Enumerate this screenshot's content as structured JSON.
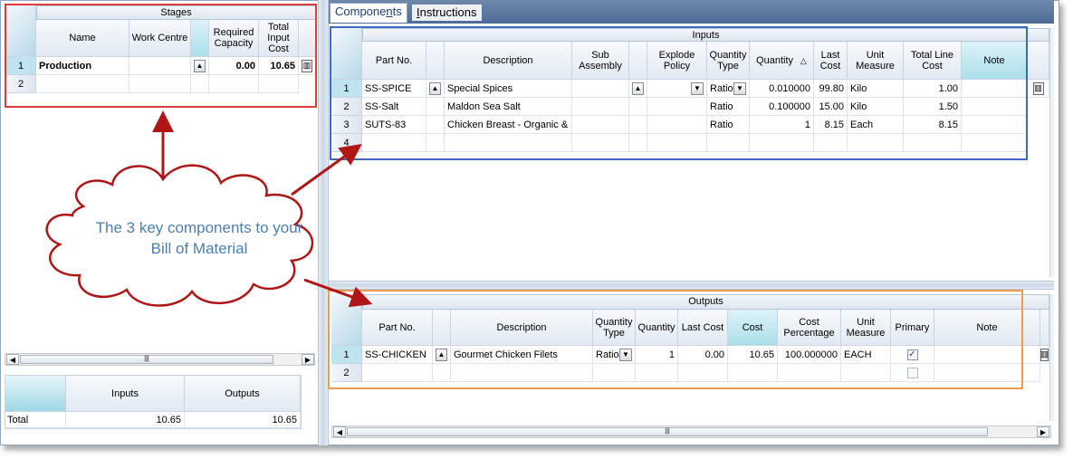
{
  "tabs": [
    {
      "label": "Components"
    },
    {
      "label": "Instructions"
    }
  ],
  "stages": {
    "title": "Stages",
    "headers": {
      "name": "Name",
      "work_centre": "Work Centre",
      "required_capacity": "Required Capacity",
      "total_input_cost": "Total Input Cost"
    },
    "rows": [
      {
        "num": "1",
        "name": "Production",
        "work_centre": "",
        "required_capacity": "0.00",
        "total_input_cost": "10.65"
      },
      {
        "num": "2",
        "name": "",
        "work_centre": "",
        "required_capacity": "",
        "total_input_cost": ""
      }
    ]
  },
  "summary": {
    "headers": {
      "inputs": "Inputs",
      "outputs": "Outputs"
    },
    "total_label": "Total",
    "inputs_total": "10.65",
    "outputs_total": "10.65"
  },
  "inputs": {
    "title": "Inputs",
    "headers": {
      "part_no": "Part No.",
      "description": "Description",
      "sub_assembly": "Sub Assembly",
      "explode_policy": "Explode Policy",
      "quantity_type": "Quantity Type",
      "quantity": "Quantity",
      "last_cost": "Last Cost",
      "unit_measure": "Unit Measure",
      "total_line_cost": "Total Line Cost",
      "note": "Note"
    },
    "rows": [
      {
        "num": "1",
        "part_no": "SS-SPICE",
        "description": "Special Spices",
        "quantity_type": "Ratio",
        "quantity": "0.010000",
        "last_cost": "99.80",
        "unit_measure": "Kilo",
        "total_line_cost": "1.00"
      },
      {
        "num": "2",
        "part_no": "SS-Salt",
        "description": "Maldon Sea Salt",
        "quantity_type": "Ratio",
        "quantity": "0.100000",
        "last_cost": "15.00",
        "unit_measure": "Kilo",
        "total_line_cost": "1.50"
      },
      {
        "num": "3",
        "part_no": "SUTS-83",
        "description": "Chicken Breast - Organic & M",
        "quantity_type": "Ratio",
        "quantity": "1",
        "last_cost": "8.15",
        "unit_measure": "Each",
        "total_line_cost": "8.15"
      },
      {
        "num": "4",
        "part_no": "",
        "description": "",
        "quantity_type": "",
        "quantity": "",
        "last_cost": "",
        "unit_measure": "",
        "total_line_cost": ""
      }
    ]
  },
  "outputs": {
    "title": "Outputs",
    "headers": {
      "part_no": "Part No.",
      "description": "Description",
      "quantity_type": "Quantity Type",
      "quantity": "Quantity",
      "last_cost": "Last Cost",
      "cost": "Cost",
      "cost_percentage": "Cost Percentage",
      "unit_measure": "Unit Measure",
      "primary": "Primary",
      "note": "Note"
    },
    "rows": [
      {
        "num": "1",
        "part_no": "SS-CHICKEN",
        "description": "Gourmet Chicken Filets",
        "quantity_type": "Ratio",
        "quantity": "1",
        "last_cost": "0.00",
        "cost": "10.65",
        "cost_percentage": "100.000000",
        "unit_measure": "EACH",
        "primary": true
      },
      {
        "num": "2",
        "part_no": "",
        "description": "",
        "quantity_type": "",
        "quantity": "",
        "last_cost": "",
        "cost": "",
        "cost_percentage": "",
        "unit_measure": "",
        "primary": false
      }
    ]
  },
  "callout": {
    "text": "The 3 key components to your Bill of Material"
  },
  "colors": {
    "red": "#e03c3c",
    "blue": "#3d6bc2",
    "orange": "#ef9a4a",
    "arrow": "#b01616",
    "cloud_text": "#4a7fb0"
  }
}
